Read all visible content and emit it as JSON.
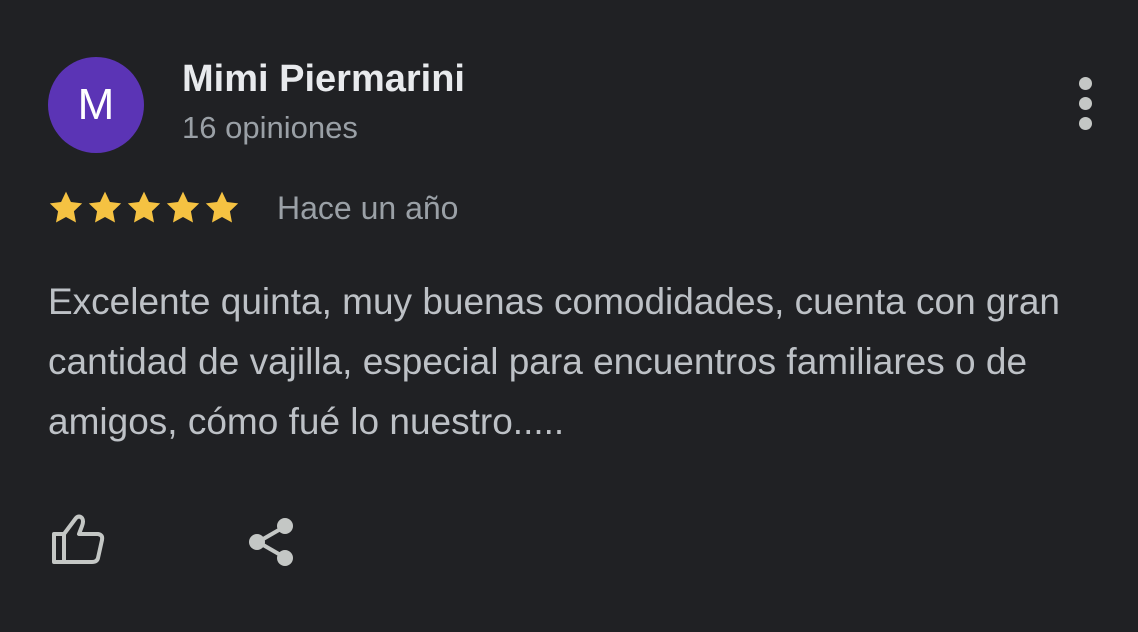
{
  "review": {
    "author": {
      "initial": "M",
      "name": "Mimi Piermarini",
      "review_count": "16 opiniones",
      "avatar_color": "#5b34b5"
    },
    "rating": 5,
    "date": "Hace un año",
    "text": "Excelente quinta, muy buenas comodidades, cuenta con gran cantidad de vajilla, especial para encuentros familiares o de amigos, cómo fué lo nuestro.....",
    "star_color": "#f5c242"
  },
  "icons": {
    "more": "more-vertical-icon",
    "like": "thumb-up-icon",
    "share": "share-icon"
  }
}
